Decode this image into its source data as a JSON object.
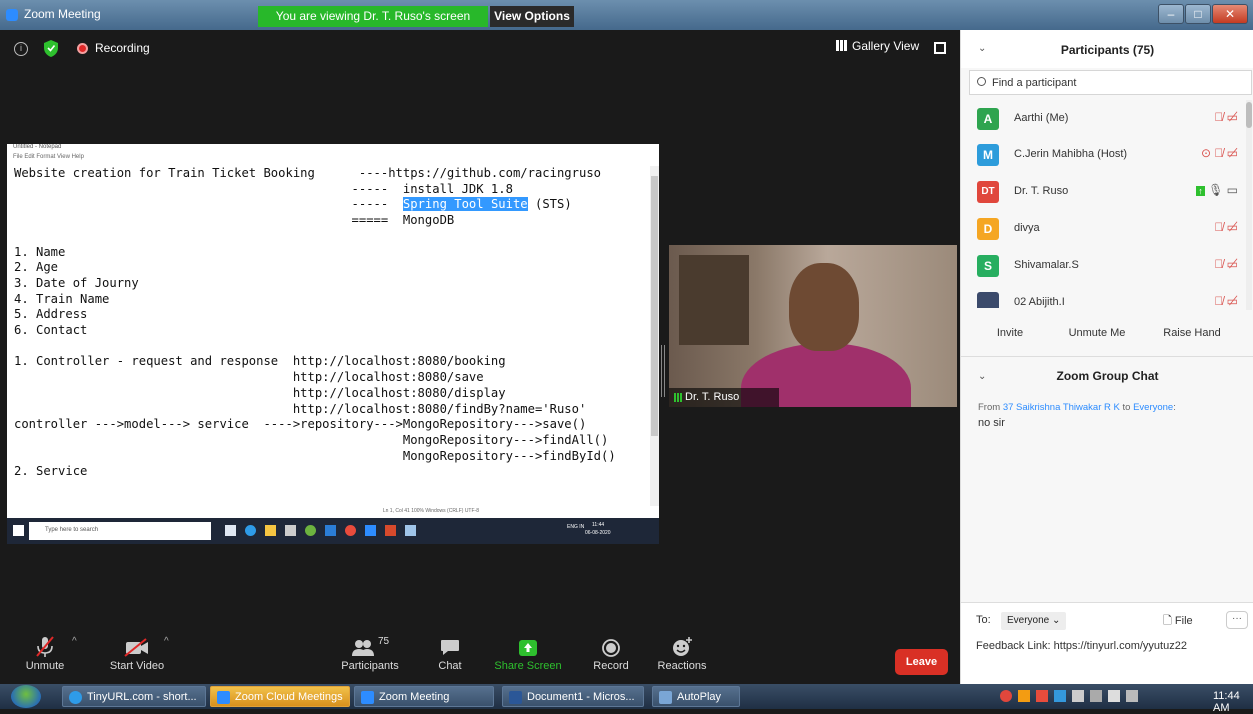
{
  "window": {
    "title": "Zoom Meeting",
    "viewing_banner": "You are viewing Dr. T. Ruso's screen",
    "view_options": "View Options ⌄"
  },
  "meeting": {
    "recording_label": "Recording",
    "gallery_view": "Gallery View"
  },
  "shared_screen": {
    "notepad_title": "Untitled - Notepad",
    "notepad_menu": "File  Edit  Format  View  Help",
    "lines_before": "Website creation for Train Ticket Booking      ----https://github.com/racingruso\n                                              -----  install JDK 1.8\n                                              -----  ",
    "highlight": "Spring Tool Suite",
    "lines_after": " (STS)\n                                              =====  MongoDB\n\n1. Name\n2. Age\n3. Date of Journy\n4. Train Name\n5. Address\n6. Contact\n\n1. Controller - request and response  http://localhost:8080/booking\n                                      http://localhost:8080/save\n                                      http://localhost:8080/display\n                                      http://localhost:8080/findBy?name='Ruso'\ncontroller --->model---> service  ---->repository--->MongoRepository--->save()\n                                                     MongoRepository--->findAll()\n                                                     MongoRepository--->findById()\n2. Service",
    "status_bar": "Ln 1, Col 41     100%    Windows (CRLF)    UTF-8",
    "taskbar_search": "Type here to search",
    "taskbar_time": "11:44",
    "taskbar_date": "06-08-2020",
    "taskbar_lang": "ENG IN"
  },
  "video": {
    "name": "Dr. T. Ruso"
  },
  "toolbar": {
    "unmute": "Unmute",
    "start_video": "Start Video",
    "participants": "Participants",
    "participants_count": "75",
    "chat": "Chat",
    "share_screen": "Share Screen",
    "record": "Record",
    "reactions": "Reactions",
    "leave": "Leave"
  },
  "panel": {
    "title": "Participants (75)",
    "search_placeholder": "Find a participant",
    "participants": [
      {
        "initials": "A",
        "name": "Aarthi (Me)",
        "color": "#2ea44f"
      },
      {
        "initials": "M",
        "name": "C.Jerin Mahibha (Host)",
        "color": "#2d9cdb"
      },
      {
        "initials": "DT",
        "name": "Dr. T. Ruso",
        "color": "#e0473c"
      },
      {
        "initials": "D",
        "name": "divya",
        "color": "#f5a623"
      },
      {
        "initials": "S",
        "name": "Shivamalar.S",
        "color": "#27ae60"
      },
      {
        "initials": "",
        "name": "02 Abijith.I",
        "color": "#3b4a6b"
      }
    ],
    "invite": "Invite",
    "unmute_me": "Unmute Me",
    "raise_hand": "Raise Hand",
    "chat_title": "Zoom Group Chat",
    "chat_from": "From",
    "chat_sender": "37 Saikrishna Thiwakar R K",
    "chat_to": "to",
    "chat_recipient": "Everyone",
    "chat_message": "no sir",
    "to_label": "To:",
    "to_value": "Everyone ⌄",
    "file": "File",
    "more": "···",
    "feedback": "Feedback Link: https://tinyurl.com/yyutuz22"
  },
  "taskbar": {
    "tasks": [
      "TinyURL.com - short...",
      "Zoom Cloud Meetings",
      "Zoom Meeting",
      "Document1 - Micros...",
      "AutoPlay"
    ],
    "time": "11:44 AM"
  }
}
